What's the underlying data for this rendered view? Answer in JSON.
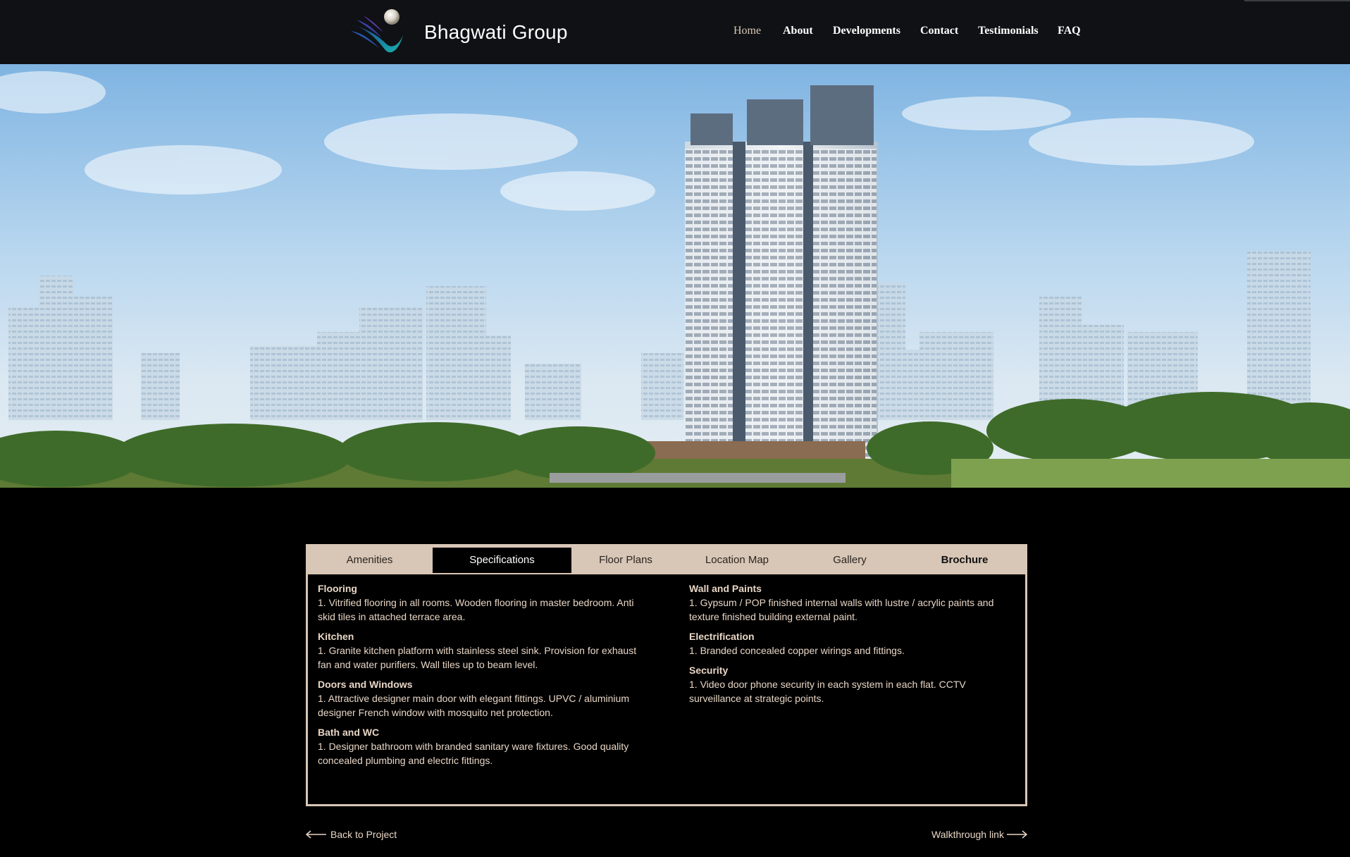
{
  "header": {
    "brand": "Bhagwati Group",
    "nav": [
      {
        "label": "Home",
        "active": true
      },
      {
        "label": "About"
      },
      {
        "label": "Developments"
      },
      {
        "label": "Contact"
      },
      {
        "label": "Testimonials"
      },
      {
        "label": "FAQ"
      }
    ]
  },
  "tabs": [
    {
      "label": "Amenities"
    },
    {
      "label": "Specifications",
      "active": true
    },
    {
      "label": "Floor Plans"
    },
    {
      "label": "Location Map"
    },
    {
      "label": "Gallery"
    },
    {
      "label": "Brochure"
    }
  ],
  "specifications": {
    "left": [
      {
        "title": "Flooring",
        "text": "1. Vitrified flooring in all rooms. Wooden flooring in master bedroom. Anti skid tiles in attached terrace area."
      },
      {
        "title": "Kitchen",
        "text": "1. Granite kitchen platform with stainless steel sink. Provision for exhaust fan and water purifiers. Wall tiles up to beam level."
      },
      {
        "title": "Doors and Windows",
        "text": "1. Attractive designer main door with elegant fittings. UPVC / aluminium designer French window with mosquito net protection."
      },
      {
        "title": "Bath and WC",
        "text": "1. Designer bathroom with branded sanitary ware fixtures. Good quality concealed plumbing and electric fittings."
      }
    ],
    "right": [
      {
        "title": "Wall and Paints",
        "text": "1. Gypsum / POP finished internal walls with lustre / acrylic paints and texture finished building external paint."
      },
      {
        "title": "Electrification",
        "text": "1. Branded concealed copper wirings and fittings."
      },
      {
        "title": "Security",
        "text": "1. Video door phone security in each system in each flat. CCTV surveillance at strategic points."
      }
    ]
  },
  "links": {
    "back": "Back to Project",
    "walkthrough": "Walkthrough link"
  },
  "colors": {
    "header_bg": "#0f1114",
    "tab_bg": "#d8c6b6",
    "text": "#e8d6c6",
    "nav_active": "#d9c6b4"
  }
}
